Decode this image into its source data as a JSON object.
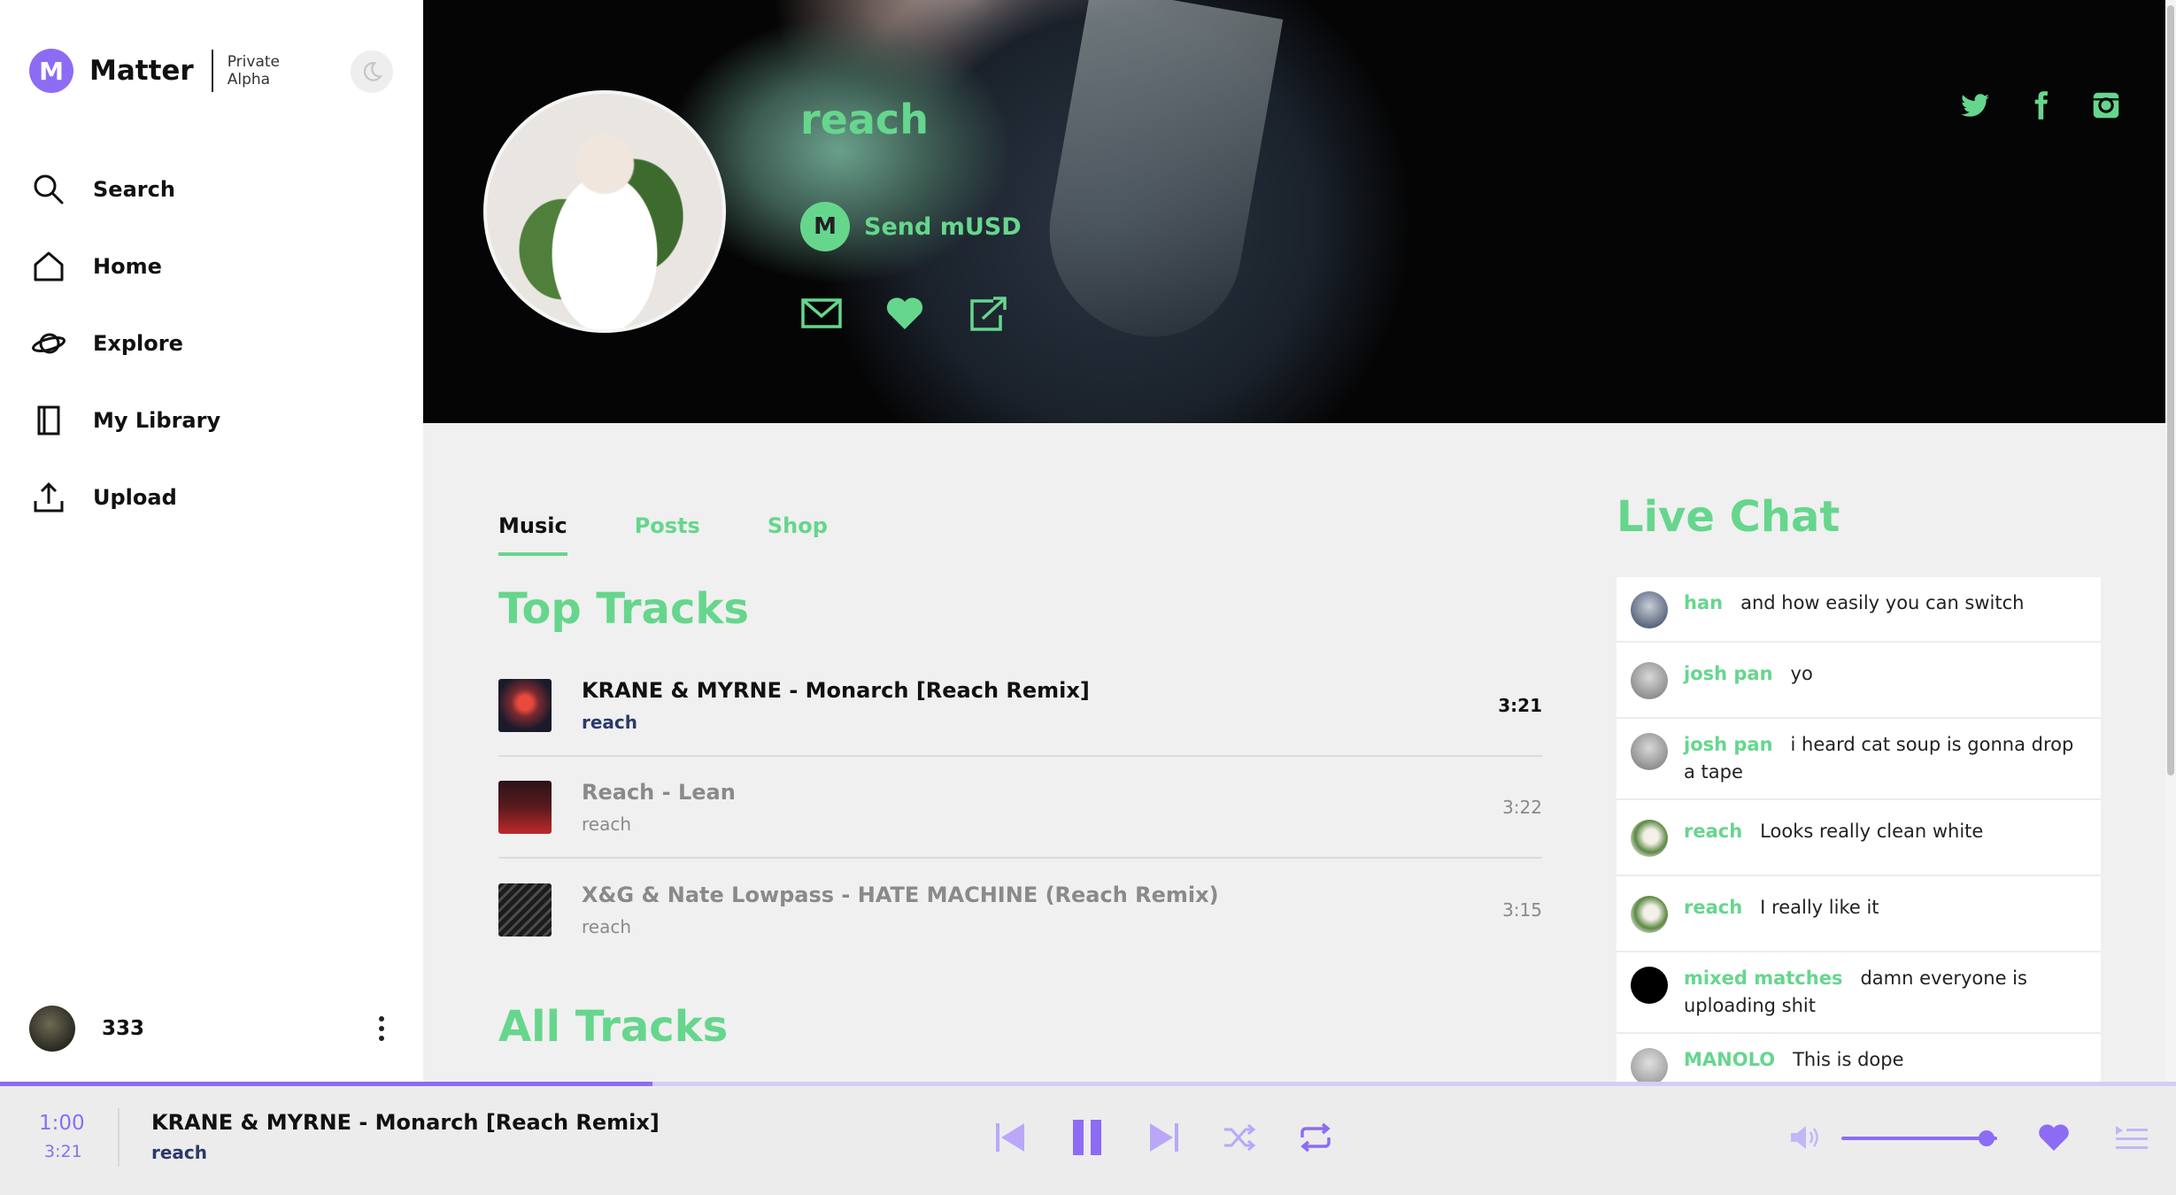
{
  "colors": {
    "accent_green": "#66d68d",
    "accent_purple": "#8c6cf4"
  },
  "brand": {
    "logo_letter": "M",
    "name": "Matter",
    "tag_line1": "Private",
    "tag_line2": "Alpha"
  },
  "nav": {
    "search": "Search",
    "home": "Home",
    "explore": "Explore",
    "library": "My Library",
    "upload": "Upload"
  },
  "user": {
    "name": "333"
  },
  "artist": {
    "name": "reach",
    "send_label": "Send mUSD",
    "send_badge": "M"
  },
  "tabs": [
    "Music",
    "Posts",
    "Shop"
  ],
  "sections": {
    "top_tracks": "Top Tracks",
    "all_tracks": "All Tracks"
  },
  "tracks": [
    {
      "title": "KRANE & MYRNE - Monarch [Reach Remix]",
      "artist": "reach",
      "duration": "3:21",
      "playing": true
    },
    {
      "title": "Reach - Lean",
      "artist": "reach",
      "duration": "3:22",
      "playing": false
    },
    {
      "title": "X&G & Nate Lowpass - HATE MACHINE (Reach Remix)",
      "artist": "reach",
      "duration": "3:15",
      "playing": false
    }
  ],
  "chat": {
    "title": "Live Chat",
    "messages": [
      {
        "user": "han",
        "text": "and how easily you can switch"
      },
      {
        "user": "josh pan",
        "text": "yo"
      },
      {
        "user": "josh pan",
        "text": "i heard cat soup is gonna drop a tape"
      },
      {
        "user": "reach",
        "text": "Looks really clean white"
      },
      {
        "user": "reach",
        "text": "I really like it"
      },
      {
        "user": "mixed matches",
        "text": "damn everyone is uploading shit"
      },
      {
        "user": "MANOLO",
        "text": "This is dope"
      }
    ]
  },
  "player": {
    "current_time": "1:00",
    "total_time": "3:21",
    "title": "KRANE & MYRNE - Monarch [Reach Remix]",
    "artist": "reach",
    "progress_fraction": 0.3,
    "volume_fraction": 0.93
  }
}
